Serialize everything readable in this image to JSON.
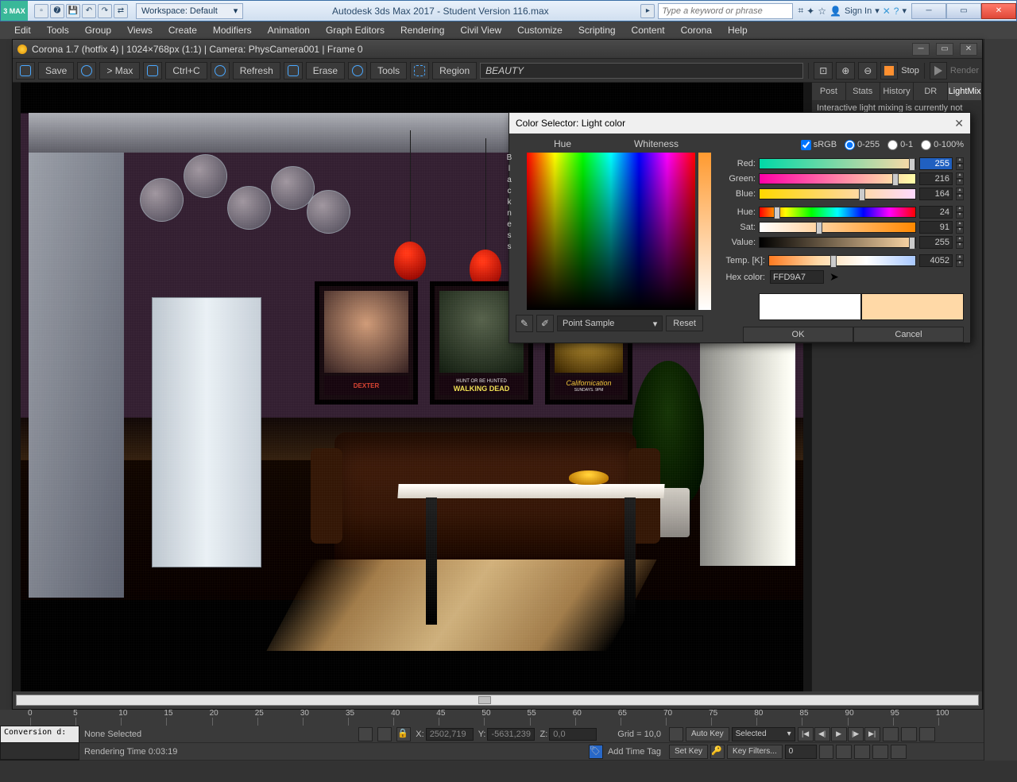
{
  "win": {
    "logo": "3 MAX",
    "workspace": "Workspace: Default",
    "title": "Autodesk 3ds Max 2017 - Student Version   116.max",
    "search_ph": "Type a keyword or phrase",
    "signin": "Sign In"
  },
  "menu": [
    "Edit",
    "Tools",
    "Group",
    "Views",
    "Create",
    "Modifiers",
    "Animation",
    "Graph Editors",
    "Rendering",
    "Civil View",
    "Customize",
    "Scripting",
    "Content",
    "Corona",
    "Help"
  ],
  "corona": {
    "title": "Corona 1.7 (hotfix 4) | 1024×768px (1:1) | Camera: PhysCamera001 | Frame 0",
    "tb": {
      "save": "Save",
      "max": "> Max",
      "ctrlc": "Ctrl+C",
      "refresh": "Refresh",
      "erase": "Erase",
      "tools": "Tools",
      "region": "Region"
    },
    "channel": "BEAUTY",
    "stop": "Stop",
    "render": "Render",
    "tabs": [
      "Post",
      "Stats",
      "History",
      "DR",
      "LightMix"
    ],
    "tab_active": 4,
    "msg": "Interactive light mixing is currently not"
  },
  "posters": {
    "p1_title": "DEXTER",
    "p2_tag": "HUNT OR BE HUNTED",
    "p2_title": "WALKING DEAD",
    "p3_title": "Californication",
    "p3_sub": "SUNDAYS. 9PM"
  },
  "cs": {
    "title": "Color Selector: Light color",
    "hue": "Hue",
    "whiteness": "Whiteness",
    "blackness": "Blackness",
    "srgb": "sRGB",
    "ranges": [
      "0-255",
      "0-1",
      "0-100%"
    ],
    "rows": {
      "red": {
        "label": "Red:",
        "val": "255"
      },
      "green": {
        "label": "Green:",
        "val": "216"
      },
      "blue": {
        "label": "Blue:",
        "val": "164"
      },
      "hue": {
        "label": "Hue:",
        "val": "24"
      },
      "sat": {
        "label": "Sat:",
        "val": "91"
      },
      "value": {
        "label": "Value:",
        "val": "255"
      },
      "temp": {
        "label": "Temp. [K]:",
        "val": "4052"
      }
    },
    "hex_label": "Hex color:",
    "hex": "FFD9A7",
    "eyedrop": "eyedropper",
    "ps": "Point Sample",
    "reset": "Reset",
    "ok": "OK",
    "cancel": "Cancel",
    "swatch_old": "#ffffff",
    "swatch_new": "#ffd9a7"
  },
  "timeline": {
    "ticks": [
      "0",
      "5",
      "10",
      "15",
      "20",
      "25",
      "30",
      "35",
      "40",
      "45",
      "50",
      "55",
      "60",
      "65",
      "70",
      "75",
      "80",
      "85",
      "90",
      "95",
      "100"
    ]
  },
  "status": {
    "script": "Conversion d:",
    "sel": "None Selected",
    "rtime": "Rendering Time  0:03:19",
    "x_lbl": "X:",
    "x": "2502,719",
    "y_lbl": "Y:",
    "y": "-5631,239",
    "z_lbl": "Z:",
    "z": "0,0",
    "grid": "Grid = 10,0",
    "addtag": "Add Time Tag",
    "autokey": "Auto Key",
    "setkey": "Set Key",
    "selected": "Selected",
    "keyfilters": "Key Filters..."
  }
}
